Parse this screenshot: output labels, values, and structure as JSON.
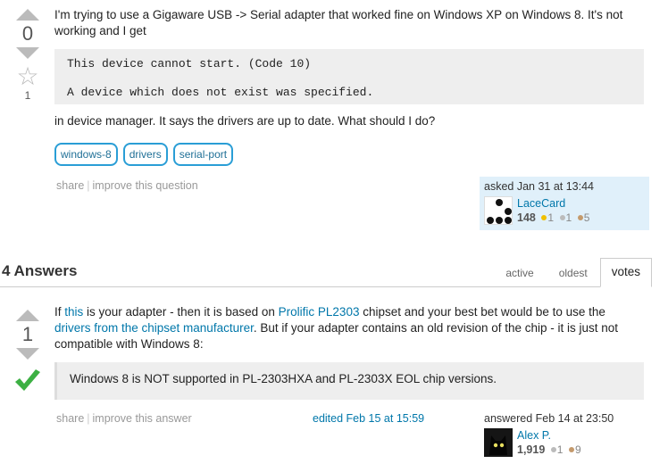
{
  "question": {
    "votes": "0",
    "favorites": "1",
    "body_line1": "I'm trying to use a Gigaware USB -> Serial adapter that worked fine on Windows XP on Windows 8. It's not working and I get",
    "code_line1": "This device cannot start. (Code 10)",
    "code_line2": "A device which does not exist was specified.",
    "body_line2": "in device manager. It says the drivers are up to date. What should I do?",
    "tags": [
      "windows-8",
      "drivers",
      "serial-port"
    ],
    "menu": {
      "share": "share",
      "improve": "improve this question"
    },
    "owner": {
      "asked": "asked Jan 31 at 13:44",
      "name": "LaceCard",
      "rep": "148",
      "gold": "1",
      "silver": "1",
      "bronze": "5"
    }
  },
  "answers_header": {
    "title": "4 Answers",
    "tabs": [
      "active",
      "oldest",
      "votes"
    ]
  },
  "answer": {
    "votes": "1",
    "text_before_link1": "If ",
    "link1": "this",
    "text_after_link1": " is your adapter - then it is based on ",
    "link2": "Prolific PL2303",
    "text_after_link2": " chipset and your best bet would be to use the ",
    "link3": "drivers from the chipset manufacturer",
    "text_after_link3": ". But if your adapter contains an old revision of the chip - it is just not compatible with Windows 8:",
    "quote": "Windows 8 is NOT supported in PL-2303HXA and PL-2303X EOL chip versions.",
    "menu": {
      "share": "share",
      "improve": "improve this answer"
    },
    "edited": "edited Feb 15 at 15:59",
    "owner": {
      "answered": "answered Feb 14 at 23:50",
      "name": "Alex P.",
      "rep": "1,919",
      "silver": "1",
      "bronze": "9"
    }
  },
  "colors": {
    "link": "#0077aa",
    "tag_border": "#2a9ed6",
    "owner_bg": "#e0f0fa",
    "accepted": "#3cb043"
  }
}
